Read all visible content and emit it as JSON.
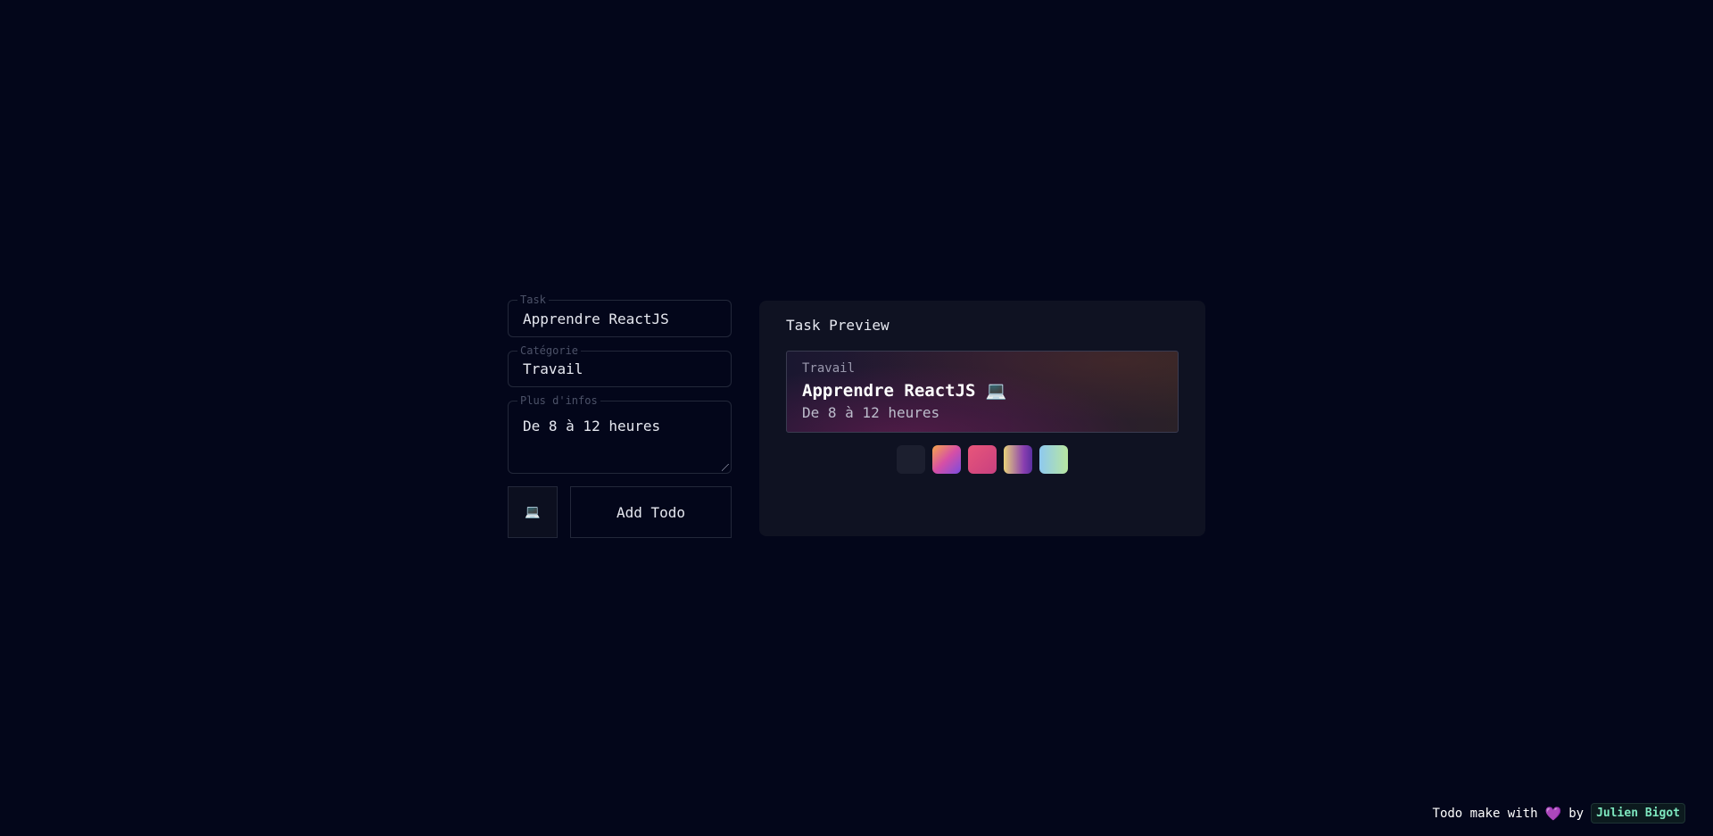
{
  "form": {
    "task": {
      "legend": "Task",
      "value": "Apprendre ReactJS"
    },
    "category": {
      "legend": "Catégorie",
      "value": "Travail"
    },
    "infos": {
      "legend": "Plus d'infos",
      "value": "De 8 à 12 heures"
    },
    "emoji": "💻",
    "add_label": "Add Todo"
  },
  "preview": {
    "title": "Task Preview",
    "card": {
      "category": "Travail",
      "title": "Apprendre ReactJS 💻",
      "infos": "De 8 à 12 heures"
    }
  },
  "footer": {
    "text": "Todo make with",
    "heart": "💜",
    "by": "by",
    "author": "Julien Bigot"
  },
  "colors": {
    "background": "#03061a",
    "panel": "#0f1222",
    "accent": "#7ee8c0"
  }
}
